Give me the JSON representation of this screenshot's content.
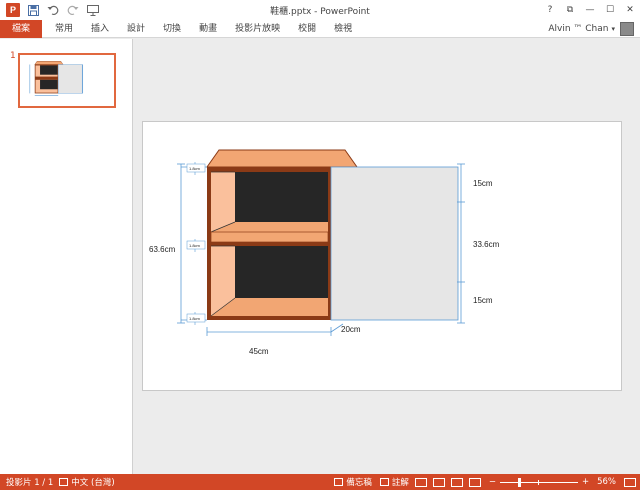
{
  "app": {
    "doc_title": "鞋櫃.pptx - PowerPoint",
    "icon_letter": "P"
  },
  "qat": {
    "icons": [
      "save-icon",
      "undo-icon",
      "redo-icon",
      "presentation-start-icon"
    ]
  },
  "window_controls": {
    "help": "?",
    "ribbon_options": "⧉",
    "minimize": "—",
    "maximize": "☐",
    "close": "✕"
  },
  "ribbon": {
    "tabs": [
      "檔案",
      "常用",
      "插入",
      "設計",
      "切換",
      "動畫",
      "投影片放映",
      "校閱",
      "檢視"
    ],
    "user_name": "Alvin ™ Chan",
    "user_caret": "▾"
  },
  "thumbnails": [
    {
      "number": "1"
    }
  ],
  "slide": {
    "labels": {
      "height_total": "63.6cm",
      "top_section": "15cm",
      "middle_section": "33.6cm",
      "bottom_section": "15cm",
      "depth": "20cm",
      "width": "45cm",
      "board_top": "1.8cm",
      "board_middle": "1.8cm",
      "board_bottom": "1.8cm"
    },
    "colors": {
      "wood_face": "#fac09c",
      "wood_edge": "#8b3a16",
      "wood_top": "#f2a673",
      "cavity": "#262626",
      "door": "#e6e6e6",
      "dimension_line": "#5b9bd5"
    }
  },
  "status": {
    "slide_indicator": "投影片 1 / 1",
    "language": "中文 (台灣)",
    "notes": "備忘稿",
    "comments": "註解",
    "zoom_minus": "−",
    "zoom_plus": "+",
    "zoom": "56%",
    "zoom_level_percent": 56
  }
}
